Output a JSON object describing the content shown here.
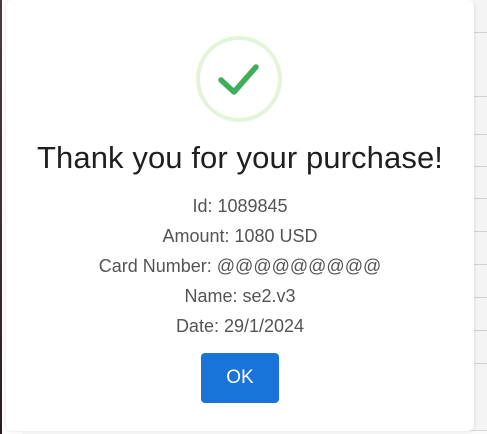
{
  "dialog": {
    "title": "Thank you for your purchase!",
    "icon": "checkmark-success-icon",
    "details": {
      "id": "Id: 1089845",
      "amount": "Amount: 1080 USD",
      "card_number": "Card Number: @@@@@@@@@",
      "name": "Name: se2.v3",
      "date": "Date: 29/1/2024"
    },
    "ok_label": "OK"
  },
  "colors": {
    "check": "#3fae5b",
    "check_ring": "#a5dc86",
    "button": "#1a73d9",
    "title_text": "#1f1f1f",
    "detail_text": "#545454"
  }
}
